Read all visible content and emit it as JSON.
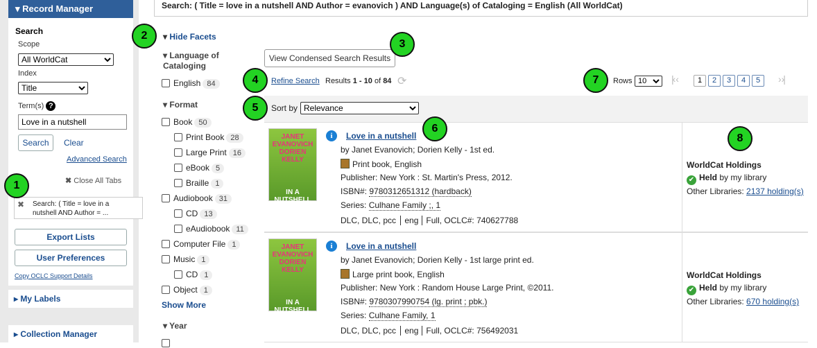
{
  "search_query": "Search: ( Title = love in a nutshell AND Author = evanovich ) AND Language(s) of Cataloging = English (All WorldCat)",
  "left": {
    "record_manager": "Record Manager",
    "search_heading": "Search",
    "scope_label": "Scope",
    "scope_value": "All WorldCat",
    "index_label": "Index",
    "index_value": "Title",
    "terms_label": "Term(s)",
    "terms_value": "Love in a nutshell",
    "search_button": "Search",
    "clear_link": "Clear",
    "advanced_search": "Advanced Search",
    "close_all_tabs": "Close All Tabs",
    "tab_text": "Search: ( Title = love in a nutshell AND Author = ...",
    "export_lists": "Export Lists",
    "user_preferences": "User Preferences",
    "copy_support": "Copy OCLC Support Details",
    "my_labels": "My Labels",
    "collection_manager": "Collection Manager"
  },
  "facets": {
    "hide_facets": "Hide Facets",
    "language_heading": "Language of Cataloging",
    "english": {
      "label": "English",
      "count": "84"
    },
    "format_heading": "Format",
    "items": [
      {
        "label": "Book",
        "count": "50"
      },
      {
        "label": "Print Book",
        "count": "28"
      },
      {
        "label": "Large Print",
        "count": "16"
      },
      {
        "label": "eBook",
        "count": "5"
      },
      {
        "label": "Braille",
        "count": "1"
      },
      {
        "label": "Audiobook",
        "count": "31"
      },
      {
        "label": "CD",
        "count": "13"
      },
      {
        "label": "eAudiobook",
        "count": "11"
      },
      {
        "label": "Computer File",
        "count": "1"
      },
      {
        "label": "Music",
        "count": "1"
      },
      {
        "label": "CD",
        "count": "1"
      },
      {
        "label": "Object",
        "count": "1"
      }
    ],
    "show_more": "Show More",
    "year_heading": "Year"
  },
  "toolbar": {
    "condensed_button": "View Condensed Search Results",
    "refine_search": "Refine Search",
    "results_prefix": "Results ",
    "results_range": "1 - 10",
    "results_of": " of ",
    "results_total": "84",
    "sort_label": "Sort by",
    "sort_value": "Relevance",
    "rows_label": "Rows",
    "rows_value": "10",
    "pages": [
      "1",
      "2",
      "3",
      "4",
      "5"
    ]
  },
  "results": [
    {
      "title": "Love in a nutshell",
      "by": "by Janet Evanovich; Dorien Kelly - 1st ed.",
      "format": "Print book, English",
      "publisher": "Publisher: New York : St. Martin's Press, 2012.",
      "isbn_label": "ISBN#:",
      "isbn": "9780312651312 (hardback)",
      "series_label": "Series:",
      "series": "Culhane Family ;, 1",
      "codes": "DLC, DLC, pcc",
      "lang": "eng",
      "level": "Full,",
      "oclc_label": "OCLC#:",
      "oclc": "740627788",
      "holdings_heading": "WorldCat Holdings",
      "held_bold": "Held",
      "held_rest": " by my library",
      "other_label": "Other Libraries:",
      "other_link": "2137 holding(s)",
      "cover_top": "JANET EVANOVICH DORIEN KELLY",
      "cover_bottom": "IN A NUTSHELL"
    },
    {
      "title": "Love in a nutshell",
      "by": "by Janet Evanovich; Dorien Kelly - 1st large print ed.",
      "format": "Large print book, English",
      "publisher": "Publisher: New York : Random House Large Print, ©2011.",
      "isbn_label": "ISBN#:",
      "isbn": "9780307990754 (lg. print ; pbk.)",
      "series_label": "Series:",
      "series": "Culhane Family, 1",
      "codes": "DLC, DLC, pcc",
      "lang": "eng",
      "level": "Full,",
      "oclc_label": "OCLC#:",
      "oclc": "756492031",
      "holdings_heading": "WorldCat Holdings",
      "held_bold": "Held",
      "held_rest": " by my library",
      "other_label": "Other Libraries:",
      "other_link": "670 holding(s)",
      "cover_top": "JANET EVANOVICH DORIEN KELLY",
      "cover_bottom": "IN A NUTSHELL"
    }
  ],
  "callouts": [
    "1",
    "2",
    "3",
    "4",
    "5",
    "6",
    "7",
    "8"
  ],
  "colors": {
    "panel_header": "#2f5f9a",
    "link": "#1a4d8f",
    "callout": "#23d323"
  }
}
